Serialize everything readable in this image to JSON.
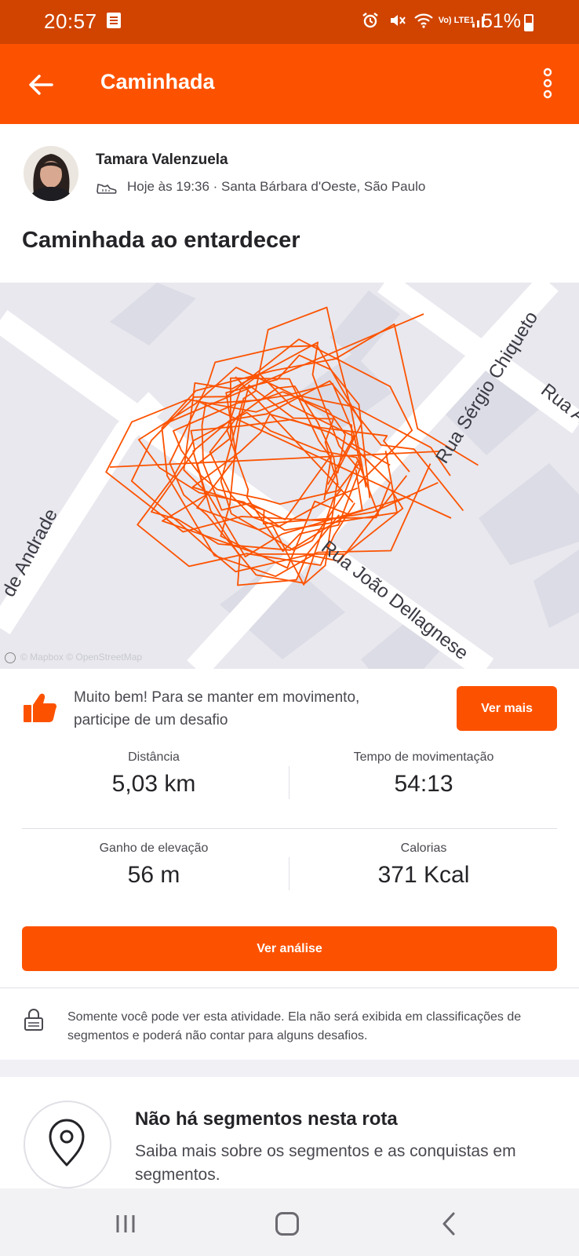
{
  "status_bar": {
    "time": "20:57",
    "network": "Vo) LTE1",
    "battery": "51%"
  },
  "app_bar": {
    "title": "Caminhada",
    "back_icon": "arrow-left-icon",
    "more_icon": "more-vertical-icon"
  },
  "athlete": {
    "name": "Tamara Valenzuela",
    "meta": "Hoje às 19:36 · Santa Bárbara d'Oeste, São Paulo",
    "activity_icon": "shoe-icon"
  },
  "activity": {
    "title": "Caminhada ao entardecer"
  },
  "map": {
    "streets": [
      "Rua Sérgio Chiqueto",
      "Rua João Dellagnese",
      "de Andrade",
      "Rua A"
    ],
    "attribution": "© Mapbox © OpenStreetMap",
    "route_color": "#fc5200"
  },
  "nudge": {
    "text": "Muito bem! Para se manter em movimento, participe de um desafio",
    "button": "Ver mais",
    "icon": "thumbs-up-icon"
  },
  "stats": [
    {
      "label": "Distância",
      "value": "5,03 km"
    },
    {
      "label": "Tempo de movimentação",
      "value": "54:13"
    },
    {
      "label": "Ganho de elevação",
      "value": "56 m"
    },
    {
      "label": "Calorias",
      "value": "371 Kcal"
    }
  ],
  "analysis_button": "Ver análise",
  "privacy": {
    "text": "Somente você pode ver esta atividade. Ela não será exibida em classificações de segmentos e poderá não contar para alguns desafios.",
    "icon": "lock-icon"
  },
  "segments": {
    "title": "Não há segmentos nesta rota",
    "text": "Saiba mais sobre os segmentos e as conquistas em segmentos.",
    "icon": "map-pin-icon"
  },
  "accent_color": "#fc5200"
}
